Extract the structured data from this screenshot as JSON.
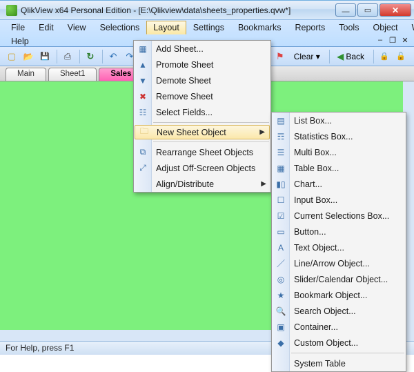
{
  "title": "QlikView x64 Personal Edition - [E:\\Qlikview\\data\\sheets_properties.qvw*]",
  "menubar": {
    "file": "File",
    "edit": "Edit",
    "view": "View",
    "selections": "Selections",
    "layout": "Layout",
    "settings": "Settings",
    "bookmarks": "Bookmarks",
    "reports": "Reports",
    "tools": "Tools",
    "object": "Object",
    "window": "Window",
    "help": "Help"
  },
  "toolbar": {
    "clear": "Clear",
    "back": "Back"
  },
  "tabs": {
    "main": "Main",
    "sheet1": "Sheet1",
    "sales": "Sales S"
  },
  "layout_menu": {
    "add_sheet": "Add Sheet...",
    "promote": "Promote Sheet",
    "demote": "Demote Sheet",
    "remove": "Remove Sheet",
    "select_fields": "Select Fields...",
    "new_obj": "New Sheet Object",
    "rearrange": "Rearrange Sheet Objects",
    "adjust": "Adjust Off-Screen Objects",
    "align": "Align/Distribute"
  },
  "submenu": {
    "list_box": "List Box...",
    "statistics_box": "Statistics Box...",
    "multi_box": "Multi Box...",
    "table_box": "Table Box...",
    "chart": "Chart...",
    "input_box": "Input Box...",
    "cur_sel": "Current Selections Box...",
    "button": "Button...",
    "text_obj": "Text Object...",
    "line": "Line/Arrow Object...",
    "slider": "Slider/Calendar Object...",
    "bookmark": "Bookmark Object...",
    "search": "Search Object...",
    "container": "Container...",
    "custom": "Custom Object...",
    "system": "System Table"
  },
  "status": "For Help, press F1"
}
